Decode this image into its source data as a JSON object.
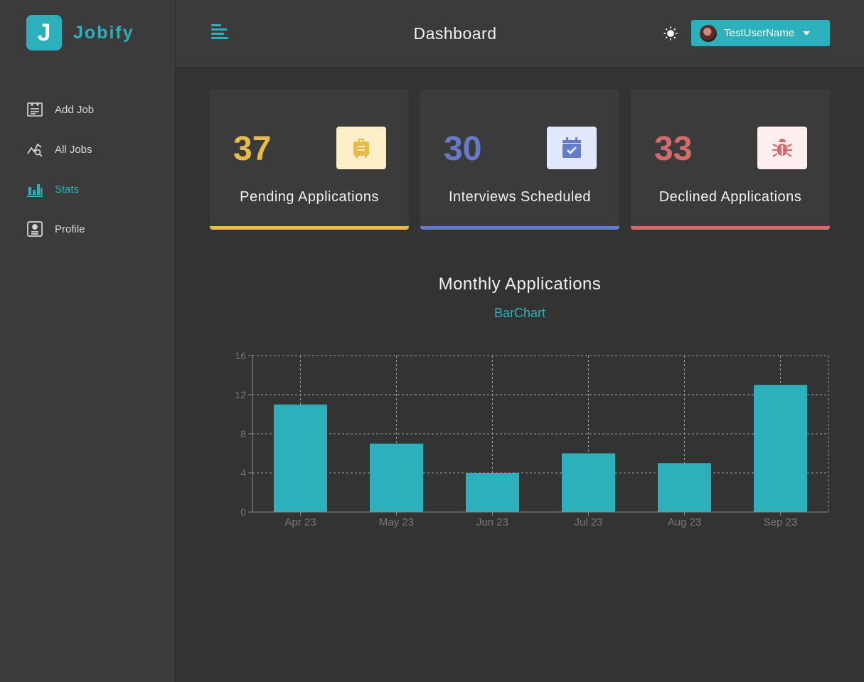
{
  "app": {
    "logo_letter": "J",
    "logo_name": "Jobify"
  },
  "header": {
    "title": "Dashboard",
    "username": "TestUserName"
  },
  "sidebar": {
    "items": [
      {
        "label": "Add Job",
        "icon": "add-job-icon",
        "active": false
      },
      {
        "label": "All Jobs",
        "icon": "all-jobs-icon",
        "active": false
      },
      {
        "label": "Stats",
        "icon": "stats-icon",
        "active": true
      },
      {
        "label": "Profile",
        "icon": "profile-icon",
        "active": false
      }
    ]
  },
  "stats": [
    {
      "count": "37",
      "label": "Pending Applications",
      "color": "#e9b949",
      "icon_bg": "#fcefc7",
      "icon": "suitcase-icon"
    },
    {
      "count": "30",
      "label": "Interviews Scheduled",
      "color": "#647acb",
      "icon_bg": "#e0e8f9",
      "icon": "calendar-check-icon"
    },
    {
      "count": "33",
      "label": "Declined Applications",
      "color": "#d66a6a",
      "icon_bg": "#ffeeee",
      "icon": "bug-icon"
    }
  ],
  "chart_section": {
    "title": "Monthly Applications",
    "toggle_label": "BarChart"
  },
  "colors": {
    "accent": "#2cb1bc",
    "background": "#333333",
    "panel": "#3b3b3b"
  },
  "chart_data": {
    "type": "bar",
    "categories": [
      "Apr 23",
      "May 23",
      "Jun 23",
      "Jul 23",
      "Aug 23",
      "Sep 23"
    ],
    "values": [
      11,
      7,
      4,
      6,
      5,
      13
    ],
    "yticks": [
      0,
      4,
      8,
      12,
      16
    ],
    "ylim": [
      0,
      16
    ],
    "grid": true,
    "bar_color": "#2cb1bc"
  }
}
